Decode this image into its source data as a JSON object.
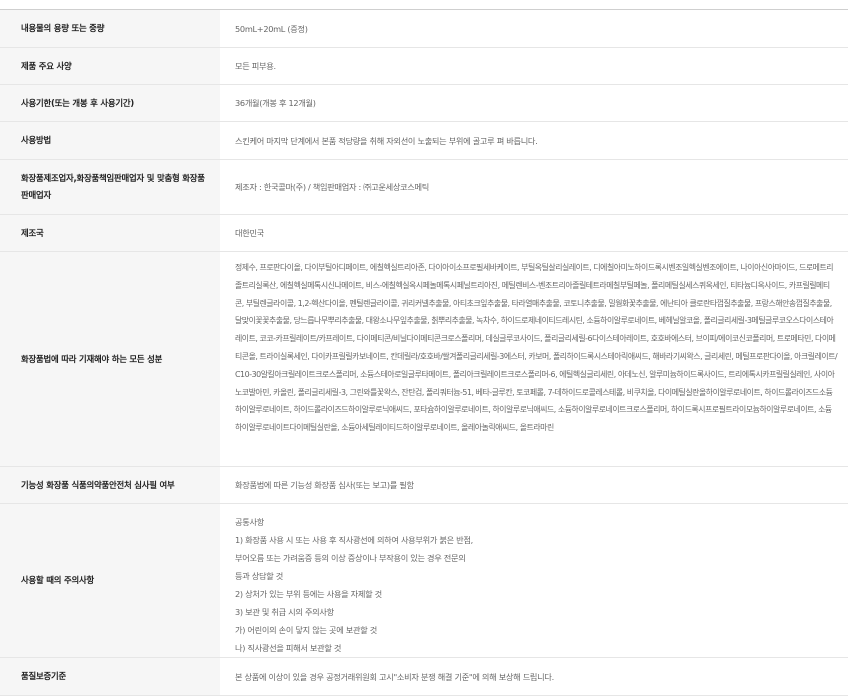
{
  "rows": [
    {
      "label": "내용물의 용량 또는 중량",
      "value": "50mL+20mL (증정)"
    },
    {
      "label": "제품 주요 사양",
      "value": "모든 피부용."
    },
    {
      "label": "사용기한(또는 개봉 후 사용기간)",
      "value": "36개월(개봉 후 12개월)"
    },
    {
      "label": "사용방법",
      "value": "스킨케어 마지막 단계에서 본품 적당량을 취해 자외선이 노출되는 부위에 골고루 펴 바릅니다."
    },
    {
      "label": "화장품제조업자,화장품책임판매업자 및 맞춤형 화장품판매업자",
      "value": "제조자 : 한국콜마(주) / 책임판매업자 : ㈜고운세상코스메틱"
    },
    {
      "label": "제조국",
      "value": "대한민국"
    },
    {
      "label": "화장품법에 따라 기재해야 하는 모든 성분",
      "value": "정제수, 프로판다이올, 다이부틸아디페이트, 에칠헥실트리아존, 다이아이소프로필세바케이트, 부틸옥틸살리실레이트, 디에칠아미노하이드록시벤조일헥실벤조에이트, 나이아신아마이드, 드로메트리졸트리실록산, 에칠헥실메톡시신나메이트, 비스-에칠헥실옥시페놀메톡시페닐트리아진, 메틸렌비스-벤조트리아졸릴테트라메칠부틸페놀, 폴리메틸실세스퀴옥세인, 티타늄디옥사이드, 카프릴릴메티콘, 부틸렌글라이콜, 1,2-헥산다이올, 펜틸렌글라이콜, 귀리커넬추출물, 아티초크잎추출물, 타라열매추출물, 코토니추출물, 밀웜화꽃추출물, 에난티아 클로란타껍질추출물, 프랑스해안송껍질추출물, 달맞이꽃꽃추출물, 당느릅나무뿌리추출물, 대왕소나무잎추출물, 칡뿌리추출물, 녹차수, 하이드로제네이티드레시틴, 소듐하이알루로네이트, 베헤닐알코올, 폴리글리세릴-3메틸글루코오스다이스테아레이트, 코코-카프릴레이트/카프레이트, 다이메티콘/비닐다이메티콘크로스폴리머, 데실글루코사이드, 폴리글리세릴-6다이스테아레이트, 호호바에스터, 브이피/에이코신코폴리머, 트로메타민, 다이메티콘올, 트라이실록세인, 다이카프릴릴카보네이트, 칸데릴라/호호바/쌀겨폴리글리세릴-3에스터, 카보머, 폴리하이드록시스테아릭애씨드, 해바라기씨왁스, 글리세린, 메틸프로판다이올, 아크릴레이트/C10-30알킬아크릴레이트크로스폴리머, 소듐스테아로일글루타메이트, 폴리아크릴레이트크로스폴리머-6, 에틸헥실글리세린, 아데노신, 알루미늄하이드록사이드, 트리에톡시카프릴릴실레인, 사이아노코발아민, 카올린, 폴리글리세릴-3, 그린와틀꽃왁스, 잔탄검, 폴리쿼터늄-51, 베타-글루칸, 토코페롤, 7-데하이드로콜레스테롤, 비쿠치올, 다이메틸실란올하이알루로네이트, 하이드롤라이즈드소듐하이알루로네이트, 하이드롤라이즈드하이알루로닉애씨드, 포타슘하이알루로네이트, 하이알루로닉애씨드, 소듐하이알루로네이트크로스폴리머, 하이드록시프로필트라이모늄하이알루로네이트, 소듐하이알루로네이트다이메틸실란올, 소듐아세틸레이티드하이알루로네이트, 올레아놀릭애씨드, 올트라마린"
    },
    {
      "label": "기능성 화장품 식품의약품안전처 심사필 여부",
      "value": "화장품법에 따른 기능성 화장품 심사(또는 보고)를 필함"
    },
    {
      "label": "사용할 때의 주의사항",
      "value": "공통사항\n1) 화장품 사용 시 또는 사용 후 직사광선에 의하여 사용부위가 붉은 반점,\n부어오름 또는 가려움증 등의 이상 증상이나 부작용이 있는 경우 전문의\n등과 상담할 것\n2) 상처가 있는 부위 등에는 사용을 자제할 것\n3) 보관 및 취급 시의 주의사항\n가) 어린이의 손이 닿지 않는 곳에 보관할 것\n나) 직사광선을 피해서 보관할 것"
    },
    {
      "label": "품질보증기준",
      "value": "본 상품에 이상이 있을 경우 공정거래위원회 고시\"소비자 분쟁 해결 기준\"에 의해 보상해 드립니다."
    }
  ]
}
